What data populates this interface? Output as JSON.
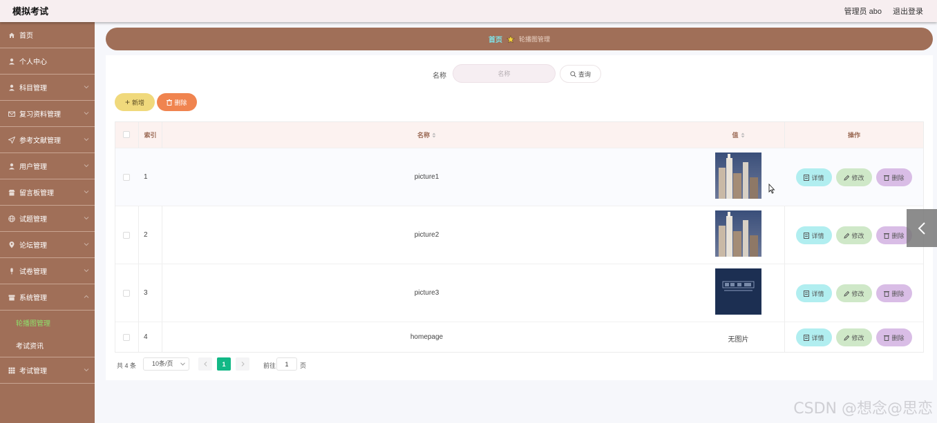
{
  "header": {
    "title": "模拟考试",
    "admin": "管理员 abo",
    "logout": "退出登录"
  },
  "sidebar": {
    "items": [
      {
        "label": "首页",
        "icon": "home-icon"
      },
      {
        "label": "个人中心",
        "icon": "user-icon"
      },
      {
        "label": "科目管理",
        "icon": "user-icon"
      },
      {
        "label": "复习资料管理",
        "icon": "mail-icon"
      },
      {
        "label": "参考文献管理",
        "icon": "send-icon"
      },
      {
        "label": "用户管理",
        "icon": "user-icon"
      },
      {
        "label": "留言板管理",
        "icon": "shop-icon"
      },
      {
        "label": "试题管理",
        "icon": "globe-icon"
      },
      {
        "label": "论坛管理",
        "icon": "pin-icon"
      },
      {
        "label": "试卷管理",
        "icon": "mic-icon"
      },
      {
        "label": "系统管理",
        "icon": "box-icon"
      }
    ],
    "sub_items": [
      {
        "label": "轮播图管理",
        "active": true
      },
      {
        "label": "考试资讯",
        "active": false
      }
    ],
    "last_item": {
      "label": "考试管理",
      "icon": "grid-icon"
    }
  },
  "breadcrumb": {
    "home": "首页",
    "current": "轮播图管理"
  },
  "search": {
    "label": "名称",
    "placeholder": "名称",
    "button": "查询"
  },
  "actions": {
    "add": "新增",
    "delete": "删除"
  },
  "table": {
    "headers": {
      "index": "索引",
      "name": "名称",
      "value": "值",
      "ops": "操作"
    },
    "rows": [
      {
        "index": "1",
        "name": "picture1",
        "image": "building"
      },
      {
        "index": "2",
        "name": "picture2",
        "image": "building"
      },
      {
        "index": "3",
        "name": "picture3",
        "image": "dark-banner"
      },
      {
        "index": "4",
        "name": "homepage",
        "image": "",
        "no_image_text": "无图片"
      }
    ],
    "op_labels": {
      "detail": "详情",
      "edit": "修改",
      "remove": "删除"
    }
  },
  "pagination": {
    "total": "共 4 条",
    "page_size": "10条/页",
    "current_page": "1",
    "goto": "前往",
    "goto_value": "1",
    "page_suffix": "页"
  },
  "watermark": "CSDN @想念@思恋",
  "colors": {
    "sidebar": "#a06f58",
    "header_bg": "#f7eef0",
    "accent_green": "#12b886",
    "detail_btn": "#b1eef0",
    "edit_btn": "#cfe8c8",
    "remove_btn": "#d9bde6",
    "add_btn": "#f0d97c",
    "delete_btn": "#f0844f"
  }
}
